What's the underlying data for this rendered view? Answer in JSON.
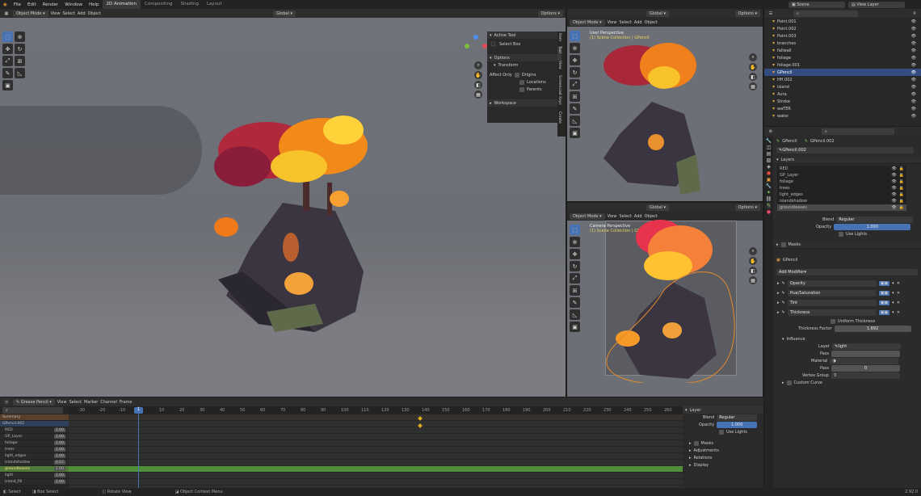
{
  "menubar": {
    "items": [
      "File",
      "Edit",
      "Render",
      "Window",
      "Help"
    ],
    "workspaces": [
      {
        "label": "2D Animation",
        "active": true
      },
      {
        "label": "Compositing"
      },
      {
        "label": "Shading"
      },
      {
        "label": "Layout"
      }
    ],
    "scene": "Scene",
    "view_layer": "View Layer"
  },
  "main_view": {
    "mode": "Object Mode",
    "menus": [
      "View",
      "Select",
      "Add",
      "Object"
    ],
    "transform": "Global",
    "options": "Options",
    "npanel": {
      "tabs": [
        "Item",
        "Tool",
        "View",
        "Screencast Keys",
        "Create"
      ],
      "active_tool": "Active Tool",
      "select_box": "Select Box",
      "options": "Options",
      "transform": "Transform",
      "affect_only": "Affect Only",
      "origins": "Origins",
      "locations": "Locations",
      "parents": "Parents",
      "workspace": "Workspace"
    }
  },
  "top_right_view": {
    "mode": "Object Mode",
    "menus": [
      "View",
      "Select",
      "Add",
      "Object"
    ],
    "transform": "Global",
    "options": "Options",
    "perspective": "User Perspective",
    "collection": "(1) Scene Collection | GPencil"
  },
  "bottom_right_view": {
    "mode": "Object Mode",
    "menus": [
      "View",
      "Select",
      "Add",
      "Object"
    ],
    "transform": "Global",
    "options": "Options",
    "perspective": "Camera Perspective",
    "collection": "(1) Scene Collection | GPencil"
  },
  "outliner": {
    "search": "",
    "items": [
      {
        "name": "Point.001"
      },
      {
        "name": "Point.002"
      },
      {
        "name": "Point.003"
      },
      {
        "name": "branches"
      },
      {
        "name": "fallwall"
      },
      {
        "name": "foliage"
      },
      {
        "name": "foliage.001"
      },
      {
        "name": "GPencil",
        "selected": true
      },
      {
        "name": "HH.002"
      },
      {
        "name": "island"
      },
      {
        "name": "Aura"
      },
      {
        "name": "Stroke"
      },
      {
        "name": "waTER"
      },
      {
        "name": "water"
      }
    ]
  },
  "properties": {
    "object_name": "GPencil",
    "data_name": "GPencil.002",
    "data_field": "GPencil.002",
    "layers_label": "Layers",
    "layers": [
      {
        "name": "RED"
      },
      {
        "name": "GP_Layer"
      },
      {
        "name": "foliage"
      },
      {
        "name": "trees"
      },
      {
        "name": "light_edges"
      },
      {
        "name": "islandshadow"
      },
      {
        "name": "groundleaves",
        "selected": true
      }
    ],
    "blend_label": "Blend",
    "blend_value": "Regular",
    "opacity_label": "Opacity",
    "opacity_value": "1.000",
    "use_lights": "Use Lights",
    "masks": "Masks",
    "mod_object": "GPencil",
    "add_modifier": "Add Modifier",
    "modifiers": [
      {
        "name": "Opacity"
      },
      {
        "name": "Hue/Saturation"
      },
      {
        "name": "Tint"
      },
      {
        "name": "Thickness"
      }
    ],
    "uniform_thickness": "Uniform Thickness",
    "thickness_factor_label": "Thickness Factor",
    "thickness_factor_value": "1.692",
    "influence": "Influence",
    "layer_label": "Layer",
    "layer_value": "light",
    "pass_label": "Pass",
    "pass_value": "0",
    "material_label": "Material",
    "vertex_group_label": "Vertex Group",
    "custom_curve": "Custom Curve"
  },
  "timeline": {
    "editor": "Grease Pencil",
    "menus": [
      "View",
      "Select",
      "Marker",
      "Channel",
      "Frame"
    ],
    "ticks": [
      "-30",
      "-20",
      "-10",
      "0",
      "10",
      "20",
      "30",
      "40",
      "50",
      "60",
      "70",
      "80",
      "90",
      "100",
      "110",
      "120",
      "130",
      "140",
      "150",
      "160",
      "170",
      "180",
      "190",
      "200",
      "210",
      "220",
      "230",
      "240",
      "250",
      "260"
    ],
    "current_frame": "1",
    "channels": [
      {
        "name": "Summary",
        "kind": "summary"
      },
      {
        "name": "GPencil.002",
        "kind": "object"
      },
      {
        "name": "RED",
        "value": "1.00"
      },
      {
        "name": "GP_Layer",
        "value": "1.00"
      },
      {
        "name": "foliage",
        "value": "1.00"
      },
      {
        "name": "trees",
        "value": "1.00"
      },
      {
        "name": "light_edges",
        "value": "1.00"
      },
      {
        "name": "islandshadow",
        "value": "0.57"
      },
      {
        "name": "groundleaves",
        "value": "1.00",
        "selected": true
      },
      {
        "name": "light",
        "value": "1.00"
      },
      {
        "name": "island_fill",
        "value": "1.00"
      }
    ],
    "side": {
      "title": "Layer",
      "blend_label": "Blend",
      "blend_value": "Regular",
      "opacity_label": "Opacity",
      "opacity_value": "1.000",
      "use_lights": "Use Lights",
      "sections": [
        "Masks",
        "Adjustments",
        "Relations",
        "Display"
      ]
    }
  },
  "statusbar": {
    "items": [
      "Select",
      "Box Select",
      "Rotate View",
      "Object Context Menu"
    ],
    "version": "2.92.0"
  },
  "colors": {
    "accent": "#4772b3",
    "selected_row": "#334d80",
    "keyframe": "#e0b020",
    "timeline_highlight": "#4f8f3a"
  }
}
